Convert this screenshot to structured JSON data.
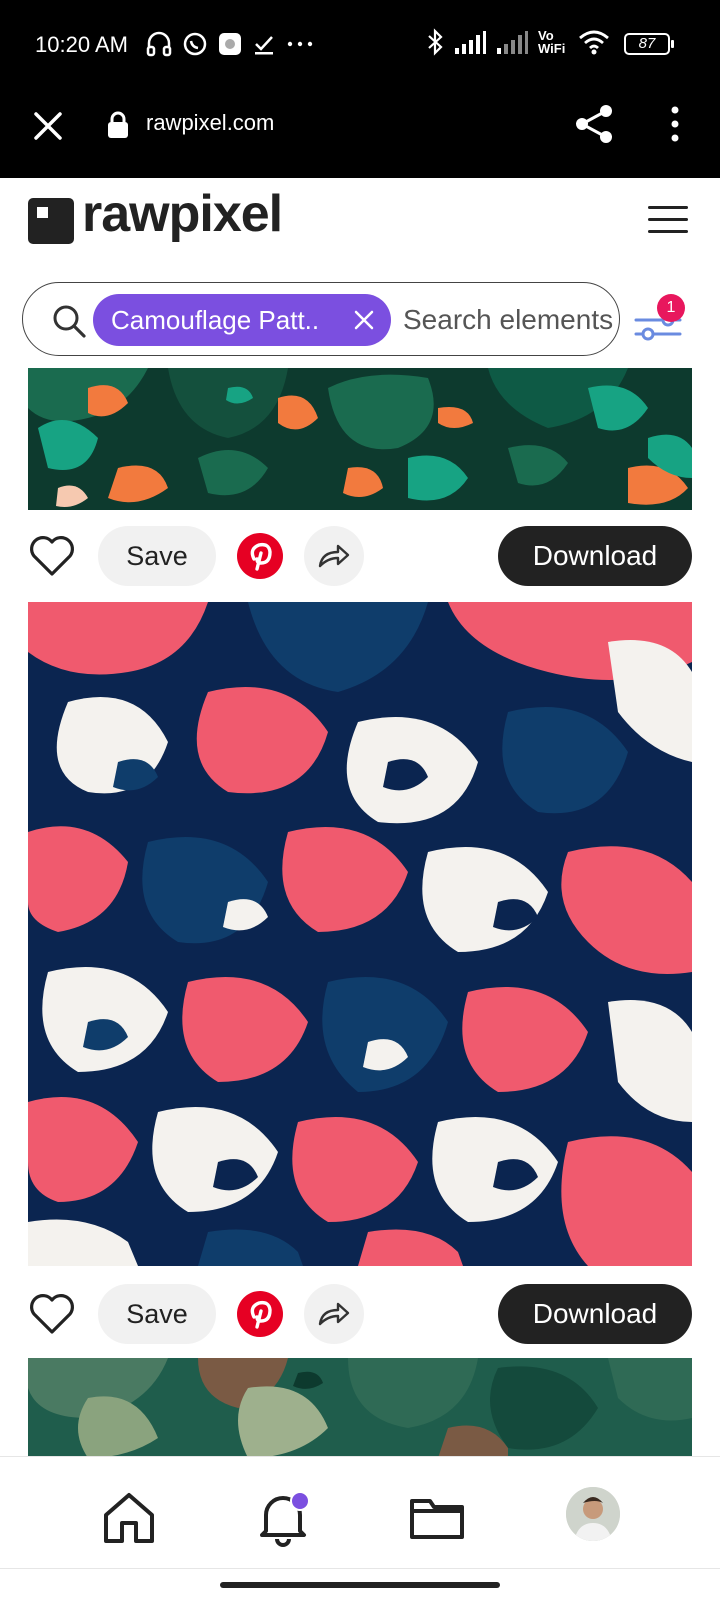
{
  "status_bar": {
    "time": "10:20 AM",
    "battery": "87",
    "network_label": "Vo WiFi"
  },
  "browser": {
    "url": "rawpixel.com"
  },
  "site": {
    "logo": "rawpixel"
  },
  "search": {
    "chip_label": "Camouflage Patt..",
    "placeholder": "Search elements",
    "filter_count": "1"
  },
  "items": [
    {
      "save_label": "Save",
      "download_label": "Download"
    },
    {
      "save_label": "Save",
      "download_label": "Download"
    }
  ],
  "icons": [
    "close-icon",
    "lock-icon",
    "share-icon",
    "more-vert-icon",
    "menu-icon",
    "search-icon",
    "filter-icon",
    "heart-icon",
    "pinterest-icon",
    "forward-icon",
    "home-icon",
    "bell-icon",
    "folder-icon"
  ],
  "colors": {
    "accent": "#7b4fe0",
    "badge": "#e8175d",
    "pinterest": "#e60023",
    "dark": "#222222"
  }
}
